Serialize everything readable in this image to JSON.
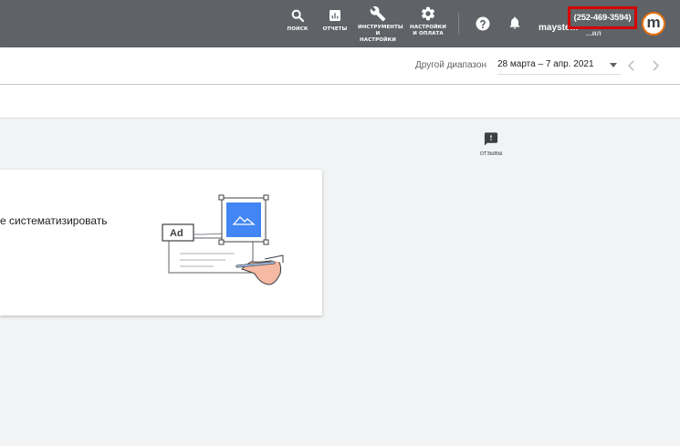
{
  "topbar": {
    "nav": [
      {
        "label": "поиск",
        "icon": "search-icon"
      },
      {
        "label": "отчеты",
        "icon": "reports-icon"
      },
      {
        "label": "инструменты и настройки",
        "icon": "wrench-icon"
      },
      {
        "label": "настройки и оплата",
        "icon": "gear-icon"
      }
    ],
    "account_name": "maystem",
    "account_name_tail": "...ил",
    "customer_id": "(252-469-3594)",
    "avatar_letter": "m"
  },
  "datebar": {
    "range_label": "Другой диапазон",
    "range_value": "28 марта – 7 апр. 2021"
  },
  "feedback": {
    "label": "отзывы"
  },
  "card": {
    "text": "е систематизировать",
    "ad_label": "Ad"
  },
  "colors": {
    "topbar": "#5f6368",
    "accent_blue": "#4285f4",
    "highlight_red": "#d50000"
  }
}
